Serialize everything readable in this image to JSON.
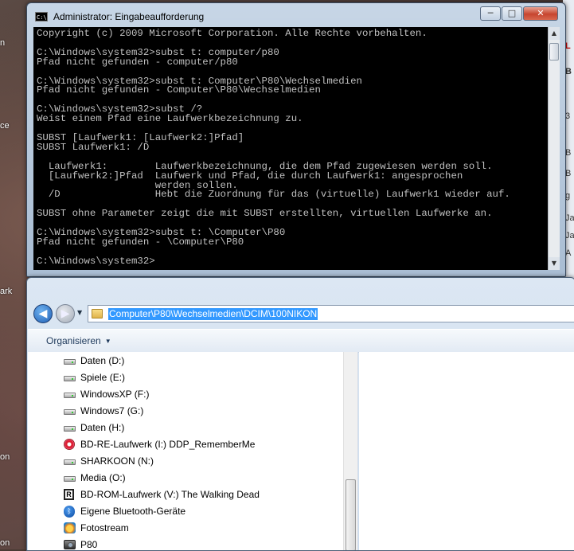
{
  "desktop": {
    "labels": [
      "n",
      "ce",
      "ark",
      "on",
      "on"
    ]
  },
  "web_fragment": {
    "rows": [
      "L",
      "B",
      "3",
      "B",
      "B",
      "g",
      "Ja",
      "Ja",
      "A"
    ]
  },
  "cmd": {
    "icon_text": "C:\\",
    "title": "Administrator: Eingabeaufforderung",
    "buttons": {
      "minimize": "─",
      "maximize": "□",
      "close": "✕"
    },
    "lines": [
      "Copyright (c) 2009 Microsoft Corporation. Alle Rechte vorbehalten.",
      "",
      "C:\\Windows\\system32>subst t: computer/p80",
      "Pfad nicht gefunden - computer/p80",
      "",
      "C:\\Windows\\system32>subst t: Computer\\P80\\Wechselmedien",
      "Pfad nicht gefunden - Computer\\P80\\Wechselmedien",
      "",
      "C:\\Windows\\system32>subst /?",
      "Weist einem Pfad eine Laufwerkbezeichnung zu.",
      "",
      "SUBST [Laufwerk1: [Laufwerk2:]Pfad]",
      "SUBST Laufwerk1: /D",
      "",
      "  Laufwerk1:        Laufwerkbezeichnung, die dem Pfad zugewiesen werden soll.",
      "  [Laufwerk2:]Pfad  Laufwerk und Pfad, die durch Laufwerk1: angesprochen",
      "                    werden sollen.",
      "  /D                Hebt die Zuordnung für das (virtuelle) Laufwerk1 wieder auf.",
      "",
      "SUBST ohne Parameter zeigt die mit SUBST erstellten, virtuellen Laufwerke an.",
      "",
      "C:\\Windows\\system32>subst t: \\Computer\\P80",
      "Pfad nicht gefunden - \\Computer\\P80",
      "",
      "C:\\Windows\\system32>"
    ]
  },
  "explorer": {
    "address_path": "Computer\\P80\\Wechselmedien\\DCIM\\100NIKON",
    "toolbar": {
      "organize_label": "Organisieren",
      "organize_caret": "▼"
    },
    "nav": {
      "back_icon": "back-arrow-icon",
      "forward_icon": "forward-arrow-icon",
      "back_glyph": "◀",
      "forward_glyph": "▶",
      "history_glyph": "▼"
    },
    "tree_items": [
      {
        "label": "Daten (D:)",
        "icon": "hard-drive-icon"
      },
      {
        "label": "Spiele (E:)",
        "icon": "hard-drive-icon"
      },
      {
        "label": "WindowsXP (F:)",
        "icon": "hard-drive-icon"
      },
      {
        "label": "Windows7 (G:)",
        "icon": "hard-drive-icon"
      },
      {
        "label": "Daten (H:)",
        "icon": "hard-drive-icon"
      },
      {
        "label": "BD-RE-Laufwerk (I:) DDP_RememberMe",
        "icon": "bd-disc-icon"
      },
      {
        "label": "SHARKOON (N:)",
        "icon": "hard-drive-icon"
      },
      {
        "label": "Media (O:)",
        "icon": "hard-drive-icon"
      },
      {
        "label": "BD-ROM-Laufwerk (V:) The Walking Dead",
        "icon": "bd-rom-icon"
      },
      {
        "label": "Eigene Bluetooth-Geräte",
        "icon": "bluetooth-icon"
      },
      {
        "label": "Fotostream",
        "icon": "photostream-icon"
      },
      {
        "label": "P80",
        "icon": "camera-icon"
      }
    ]
  }
}
